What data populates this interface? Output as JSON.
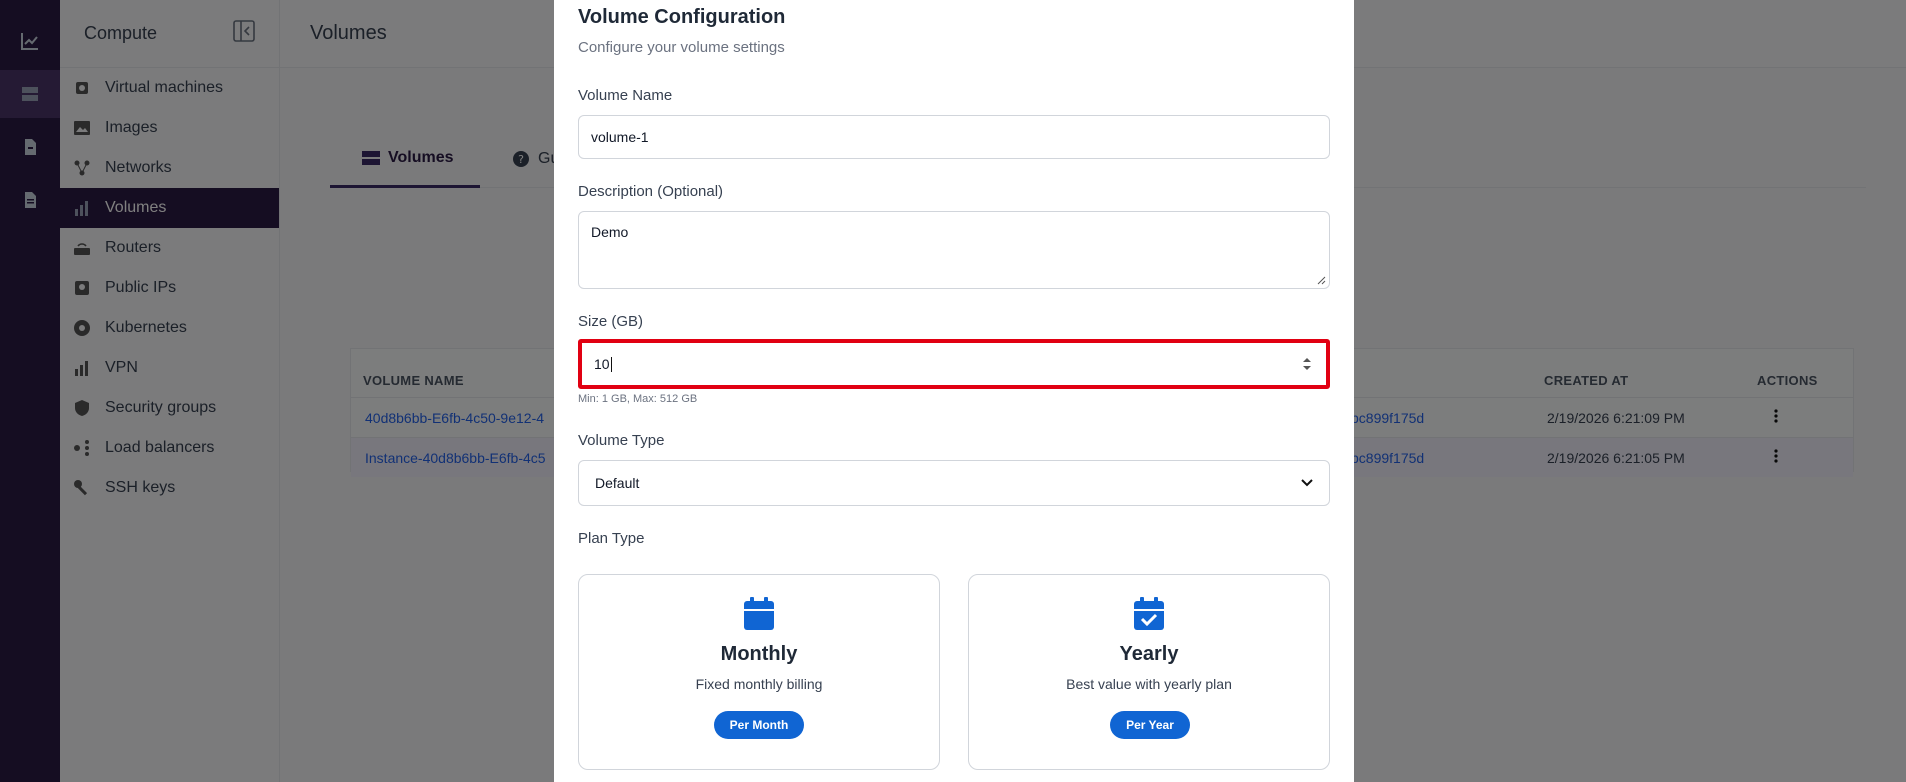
{
  "sidebar": {
    "title": "Compute",
    "items": [
      {
        "label": "Virtual machines"
      },
      {
        "label": "Images"
      },
      {
        "label": "Networks"
      },
      {
        "label": "Volumes"
      },
      {
        "label": "Routers"
      },
      {
        "label": "Public IPs"
      },
      {
        "label": "Kubernetes"
      },
      {
        "label": "VPN"
      },
      {
        "label": "Security groups"
      },
      {
        "label": "Load balancers"
      },
      {
        "label": "SSH keys"
      }
    ],
    "active_index": 3
  },
  "main": {
    "title": "Volumes",
    "tabs": [
      {
        "label": "Volumes"
      },
      {
        "label": "Gu"
      }
    ],
    "table": {
      "headers": [
        "VOLUME NAME",
        "CREATED AT",
        "ACTIONS"
      ],
      "rows": [
        {
          "name": "40d8b6bb-E6fb-4c50-9e12-4",
          "instance": "bc899f175d",
          "created": "2/19/2026 6:21:09 PM"
        },
        {
          "name": "Instance-40d8b6bb-E6fb-4c5",
          "instance": "bc899f175d",
          "created": "2/19/2026 6:21:05 PM"
        }
      ]
    }
  },
  "modal": {
    "title": "Volume Configuration",
    "subtitle": "Configure your volume settings",
    "name_label": "Volume Name",
    "name_value": "volume-1",
    "desc_label": "Description (Optional)",
    "desc_value": "Demo",
    "size_label": "Size (GB)",
    "size_value": "10",
    "size_hint": "Min: 1 GB, Max: 512 GB",
    "type_label": "Volume Type",
    "type_value": "Default",
    "plan_label": "Plan Type",
    "plans": [
      {
        "name": "Monthly",
        "desc": "Fixed monthly billing",
        "button": "Per Month",
        "icon": "calendar-icon"
      },
      {
        "name": "Yearly",
        "desc": "Best value with yearly plan",
        "button": "Per Year",
        "icon": "calendar-check-icon"
      }
    ]
  },
  "colors": {
    "rail": "#2b1a45",
    "accent": "#1065d3",
    "highlight": "#e10012"
  }
}
